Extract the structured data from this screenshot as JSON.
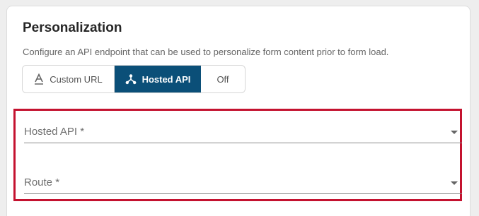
{
  "section": {
    "title": "Personalization",
    "description": "Configure an API endpoint that can be used to personalize form content prior to form load."
  },
  "toggle": {
    "options": [
      {
        "label": "Custom URL",
        "icon": "custom-url-icon",
        "selected": false
      },
      {
        "label": "Hosted API",
        "icon": "hosted-api-icon",
        "selected": true
      },
      {
        "label": "Off",
        "icon": null,
        "selected": false
      }
    ]
  },
  "fields": {
    "hosted_api": {
      "label": "Hosted API *",
      "value": ""
    },
    "route": {
      "label": "Route *",
      "value": ""
    }
  },
  "colors": {
    "selected_toggle": "#0b4f78",
    "highlight_border": "#c4122f"
  }
}
